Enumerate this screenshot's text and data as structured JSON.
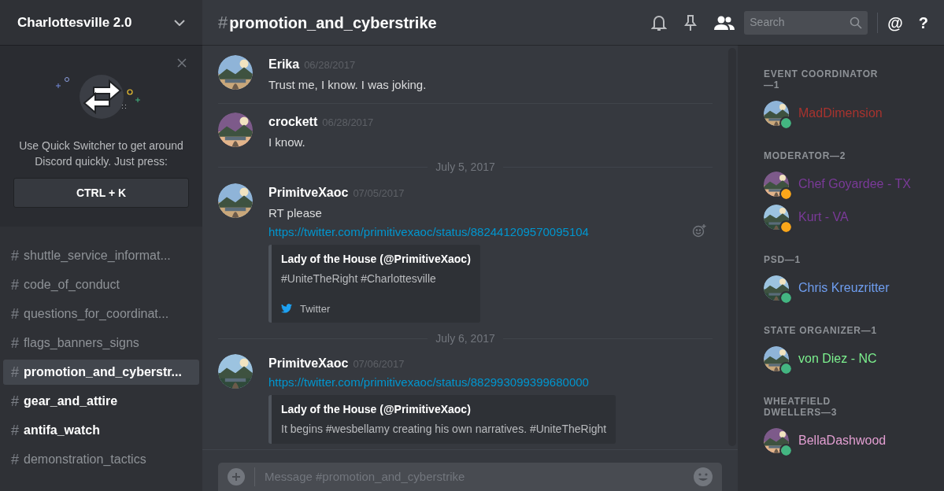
{
  "server": {
    "name": "Charlottesville 2.0"
  },
  "quick_switcher": {
    "text": "Use Quick Switcher to get around Discord quickly. Just press:",
    "shortcut": "CTRL + K"
  },
  "channels": [
    {
      "icon": "#",
      "name": "shuttle_service_informat...",
      "selected": false,
      "unread": false
    },
    {
      "icon": "#",
      "name": "code_of_conduct",
      "selected": false,
      "unread": false
    },
    {
      "icon": "#",
      "name": "questions_for_coordinat...",
      "selected": false,
      "unread": false
    },
    {
      "icon": "#",
      "name": "flags_banners_signs",
      "selected": false,
      "unread": false
    },
    {
      "icon": "#",
      "name": "promotion_and_cyberstr...",
      "selected": true,
      "unread": false
    },
    {
      "icon": "#",
      "name": "gear_and_attire",
      "selected": false,
      "unread": true
    },
    {
      "icon": "#",
      "name": "antifa_watch",
      "selected": false,
      "unread": true
    },
    {
      "icon": "#",
      "name": "demonstration_tactics",
      "selected": false,
      "unread": false
    }
  ],
  "header": {
    "hash": "#",
    "channel": "promotion_and_cyberstrike",
    "search_placeholder": "Search",
    "mention": "@",
    "help": "?"
  },
  "messages": [
    {
      "kind": "message",
      "author": "Erika",
      "time": "06/28/2017",
      "content": [
        {
          "kind": "text",
          "text": "Trust me, I know. I was joking."
        }
      ]
    },
    {
      "kind": "message",
      "author": "crockett",
      "time": "06/28/2017",
      "content": [
        {
          "kind": "text",
          "text": "I know."
        }
      ]
    },
    {
      "kind": "date",
      "text": "July 5, 2017"
    },
    {
      "kind": "message",
      "author": "PrimitveXaoc",
      "time": "07/05/2017",
      "hovered": true,
      "content": [
        {
          "kind": "text",
          "text": "RT please"
        },
        {
          "kind": "link",
          "text": "https://twitter.com/primitivexaoc/status/882441209570095104"
        },
        {
          "kind": "embed",
          "title": "Lady of the House (@PrimitiveXaoc)",
          "description": "#UniteTheRight #Charlottesville",
          "footer": "Twitter"
        }
      ]
    },
    {
      "kind": "date",
      "text": "July 6, 2017"
    },
    {
      "kind": "message",
      "author": "PrimitveXaoc",
      "time": "07/06/2017",
      "content": [
        {
          "kind": "link",
          "text": "https://twitter.com/primitivexaoc/status/882993099399680000"
        },
        {
          "kind": "embed",
          "title": "Lady of the House (@PrimitiveXaoc)",
          "description": "It begins #wesbellamy creating his own narratives. #UniteTheRight"
        }
      ]
    }
  ],
  "composer": {
    "placeholder": "Message #promotion_and_cyberstrike"
  },
  "member_groups": [
    {
      "title": "EVENT COORDINATOR—1",
      "members": [
        {
          "name": "MadDimension",
          "color": "#a8332e",
          "status": {
            "color": "#43b581"
          }
        }
      ]
    },
    {
      "title": "MODERATOR—2",
      "members": [
        {
          "name": "Chef Goyardee - TX",
          "color": "#7a3a98",
          "status": {
            "color": "#faa61a"
          }
        },
        {
          "name": "Kurt - VA",
          "color": "#7a3a98",
          "status": {
            "color": "#faa61a"
          }
        }
      ]
    },
    {
      "title": "PSD—1",
      "members": [
        {
          "name": "Chris Kreuzritter",
          "color": "#6f9ef0",
          "status": {
            "color": "#43b581"
          }
        }
      ]
    },
    {
      "title": "STATE ORGANIZER—1",
      "members": [
        {
          "name": "von Diez - NC",
          "color": "#7cf08e",
          "status": {
            "color": "#43b581"
          }
        }
      ]
    },
    {
      "title": "WHEATFIELD DWELLERS—3",
      "members": [
        {
          "name": "BellaDashwood",
          "color": "#e39fd2",
          "status": {
            "color": "#43b581"
          }
        }
      ]
    }
  ]
}
